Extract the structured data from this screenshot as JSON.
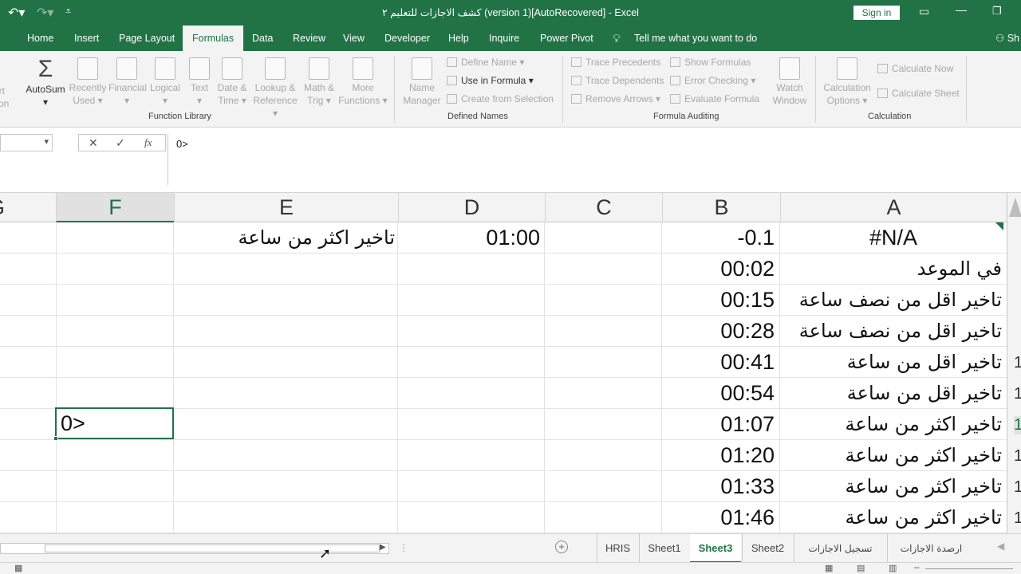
{
  "window": {
    "title": "كشف الاجازات للتعليم ٢ (version 1)[AutoRecovered]  -  Excel",
    "signin": "Sign in",
    "user_initials": "Sh"
  },
  "menu_tabs": [
    "Home",
    "Insert",
    "Page Layout",
    "Formulas",
    "Data",
    "Review",
    "View",
    "Developer",
    "Help",
    "Inquire",
    "Power Pivot"
  ],
  "active_tab": "Formulas",
  "tell_me": "Tell me what you want to do",
  "ribbon": {
    "insert_fn": [
      "ert",
      "tion"
    ],
    "autosum": "AutoSum",
    "recently_used": [
      "Recently",
      "Used"
    ],
    "financial": "Financial",
    "logical": "Logical",
    "text": "Text",
    "date_time": [
      "Date &",
      "Time"
    ],
    "lookup": [
      "Lookup &",
      "Reference"
    ],
    "math": [
      "Math &",
      "Trig"
    ],
    "more": [
      "More",
      "Functions"
    ],
    "function_library": "Function Library",
    "name_manager": [
      "Name",
      "Manager"
    ],
    "define_name": "Define Name",
    "use_in_formula": "Use in Formula",
    "create_from_selection": "Create from Selection",
    "defined_names": "Defined Names",
    "trace_precedents": "Trace Precedents",
    "trace_dependents": "Trace Dependents",
    "remove_arrows": "Remove Arrows",
    "show_formulas": "Show Formulas",
    "error_checking": "Error Checking",
    "evaluate_formula": "Evaluate Formula",
    "watch_window": [
      "Watch",
      "Window"
    ],
    "formula_auditing": "Formula Auditing",
    "calc_options": [
      "Calculation",
      "Options"
    ],
    "calculate_now": "Calculate Now",
    "calculate_sheet": "Calculate Sheet",
    "calculation": "Calculation"
  },
  "formula_bar": {
    "cancel": "✕",
    "enter": "✓",
    "fx": "fx",
    "content": "0>"
  },
  "columns": [
    "G",
    "F",
    "E",
    "D",
    "C",
    "B",
    "A"
  ],
  "selected_column": "F",
  "cells": {
    "A": [
      "#N/A",
      "في الموعد",
      "تاخير اقل من نصف ساعة",
      "تاخير اقل من نصف ساعة",
      "تاخير اقل من ساعة",
      "تاخير اقل من ساعة",
      "تاخير اكثر  من ساعة",
      "تاخير اكثر  من ساعة",
      "تاخير اكثر  من ساعة",
      "تاخير اكثر  من ساعة"
    ],
    "B": [
      "-0.1",
      "00:02",
      "00:15",
      "00:28",
      "00:41",
      "00:54",
      "01:07",
      "01:20",
      "01:33",
      "01:46"
    ],
    "D1": "01:00",
    "E1": "تاخير اكثر  من ساعة",
    "F7": "0>"
  },
  "row_numbers": [
    "1",
    "1",
    "1",
    "1",
    "1",
    "1"
  ],
  "sheets": [
    "HRIS",
    "Sheet1",
    "Sheet3",
    "Sheet2",
    "تسجيل الاجازات",
    "ارصدة الاجازات"
  ],
  "active_sheet": "Sheet3"
}
